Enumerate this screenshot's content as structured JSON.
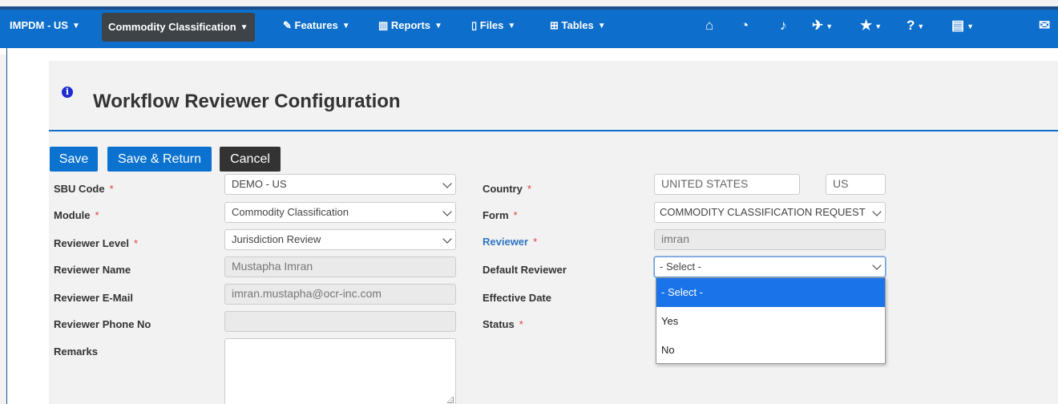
{
  "nav": {
    "brand": "IMPDM - US",
    "module": "Commodity Classification",
    "features": "Features",
    "reports": "Reports",
    "files": "Files",
    "tables": "Tables",
    "icons": [
      "home-icon",
      "dashboard-icon",
      "bell-icon",
      "wrench-icon",
      "star-icon",
      "help-icon",
      "notebook-icon",
      "mail-icon"
    ]
  },
  "page": {
    "title": "Workflow Reviewer Configuration"
  },
  "toolbar": {
    "save": "Save",
    "save_return": "Save & Return",
    "cancel": "Cancel"
  },
  "form": {
    "sbu_code": {
      "label": "SBU Code",
      "value": "DEMO - US"
    },
    "module": {
      "label": "Module",
      "value": "Commodity Classification"
    },
    "reviewer_level": {
      "label": "Reviewer Level",
      "value": "Jurisdiction Review"
    },
    "reviewer_name": {
      "label": "Reviewer Name",
      "value": "Mustapha Imran"
    },
    "reviewer_email": {
      "label": "Reviewer E-Mail",
      "value": "imran.mustapha@ocr-inc.com"
    },
    "reviewer_phone": {
      "label": "Reviewer Phone No",
      "value": ""
    },
    "remarks": {
      "label": "Remarks",
      "value": ""
    },
    "country": {
      "label": "Country",
      "value": "UNITED STATES",
      "code": "US"
    },
    "form": {
      "label": "Form",
      "value": "COMMODITY CLASSIFICATION REQUEST"
    },
    "reviewer": {
      "label": "Reviewer",
      "value": "imran"
    },
    "default_reviewer": {
      "label": "Default Reviewer",
      "value": "- Select -",
      "options": [
        "- Select -",
        "Yes",
        "No"
      ]
    },
    "effective_date": {
      "label": "Effective Date"
    },
    "status": {
      "label": "Status"
    },
    "required_mark": "*"
  },
  "colors": {
    "nav_bg": "#0d6ecb",
    "primary_button": "#0b72cf",
    "dark_button": "#333333",
    "required": "#e03c3c",
    "highlight": "#1a73e8"
  }
}
